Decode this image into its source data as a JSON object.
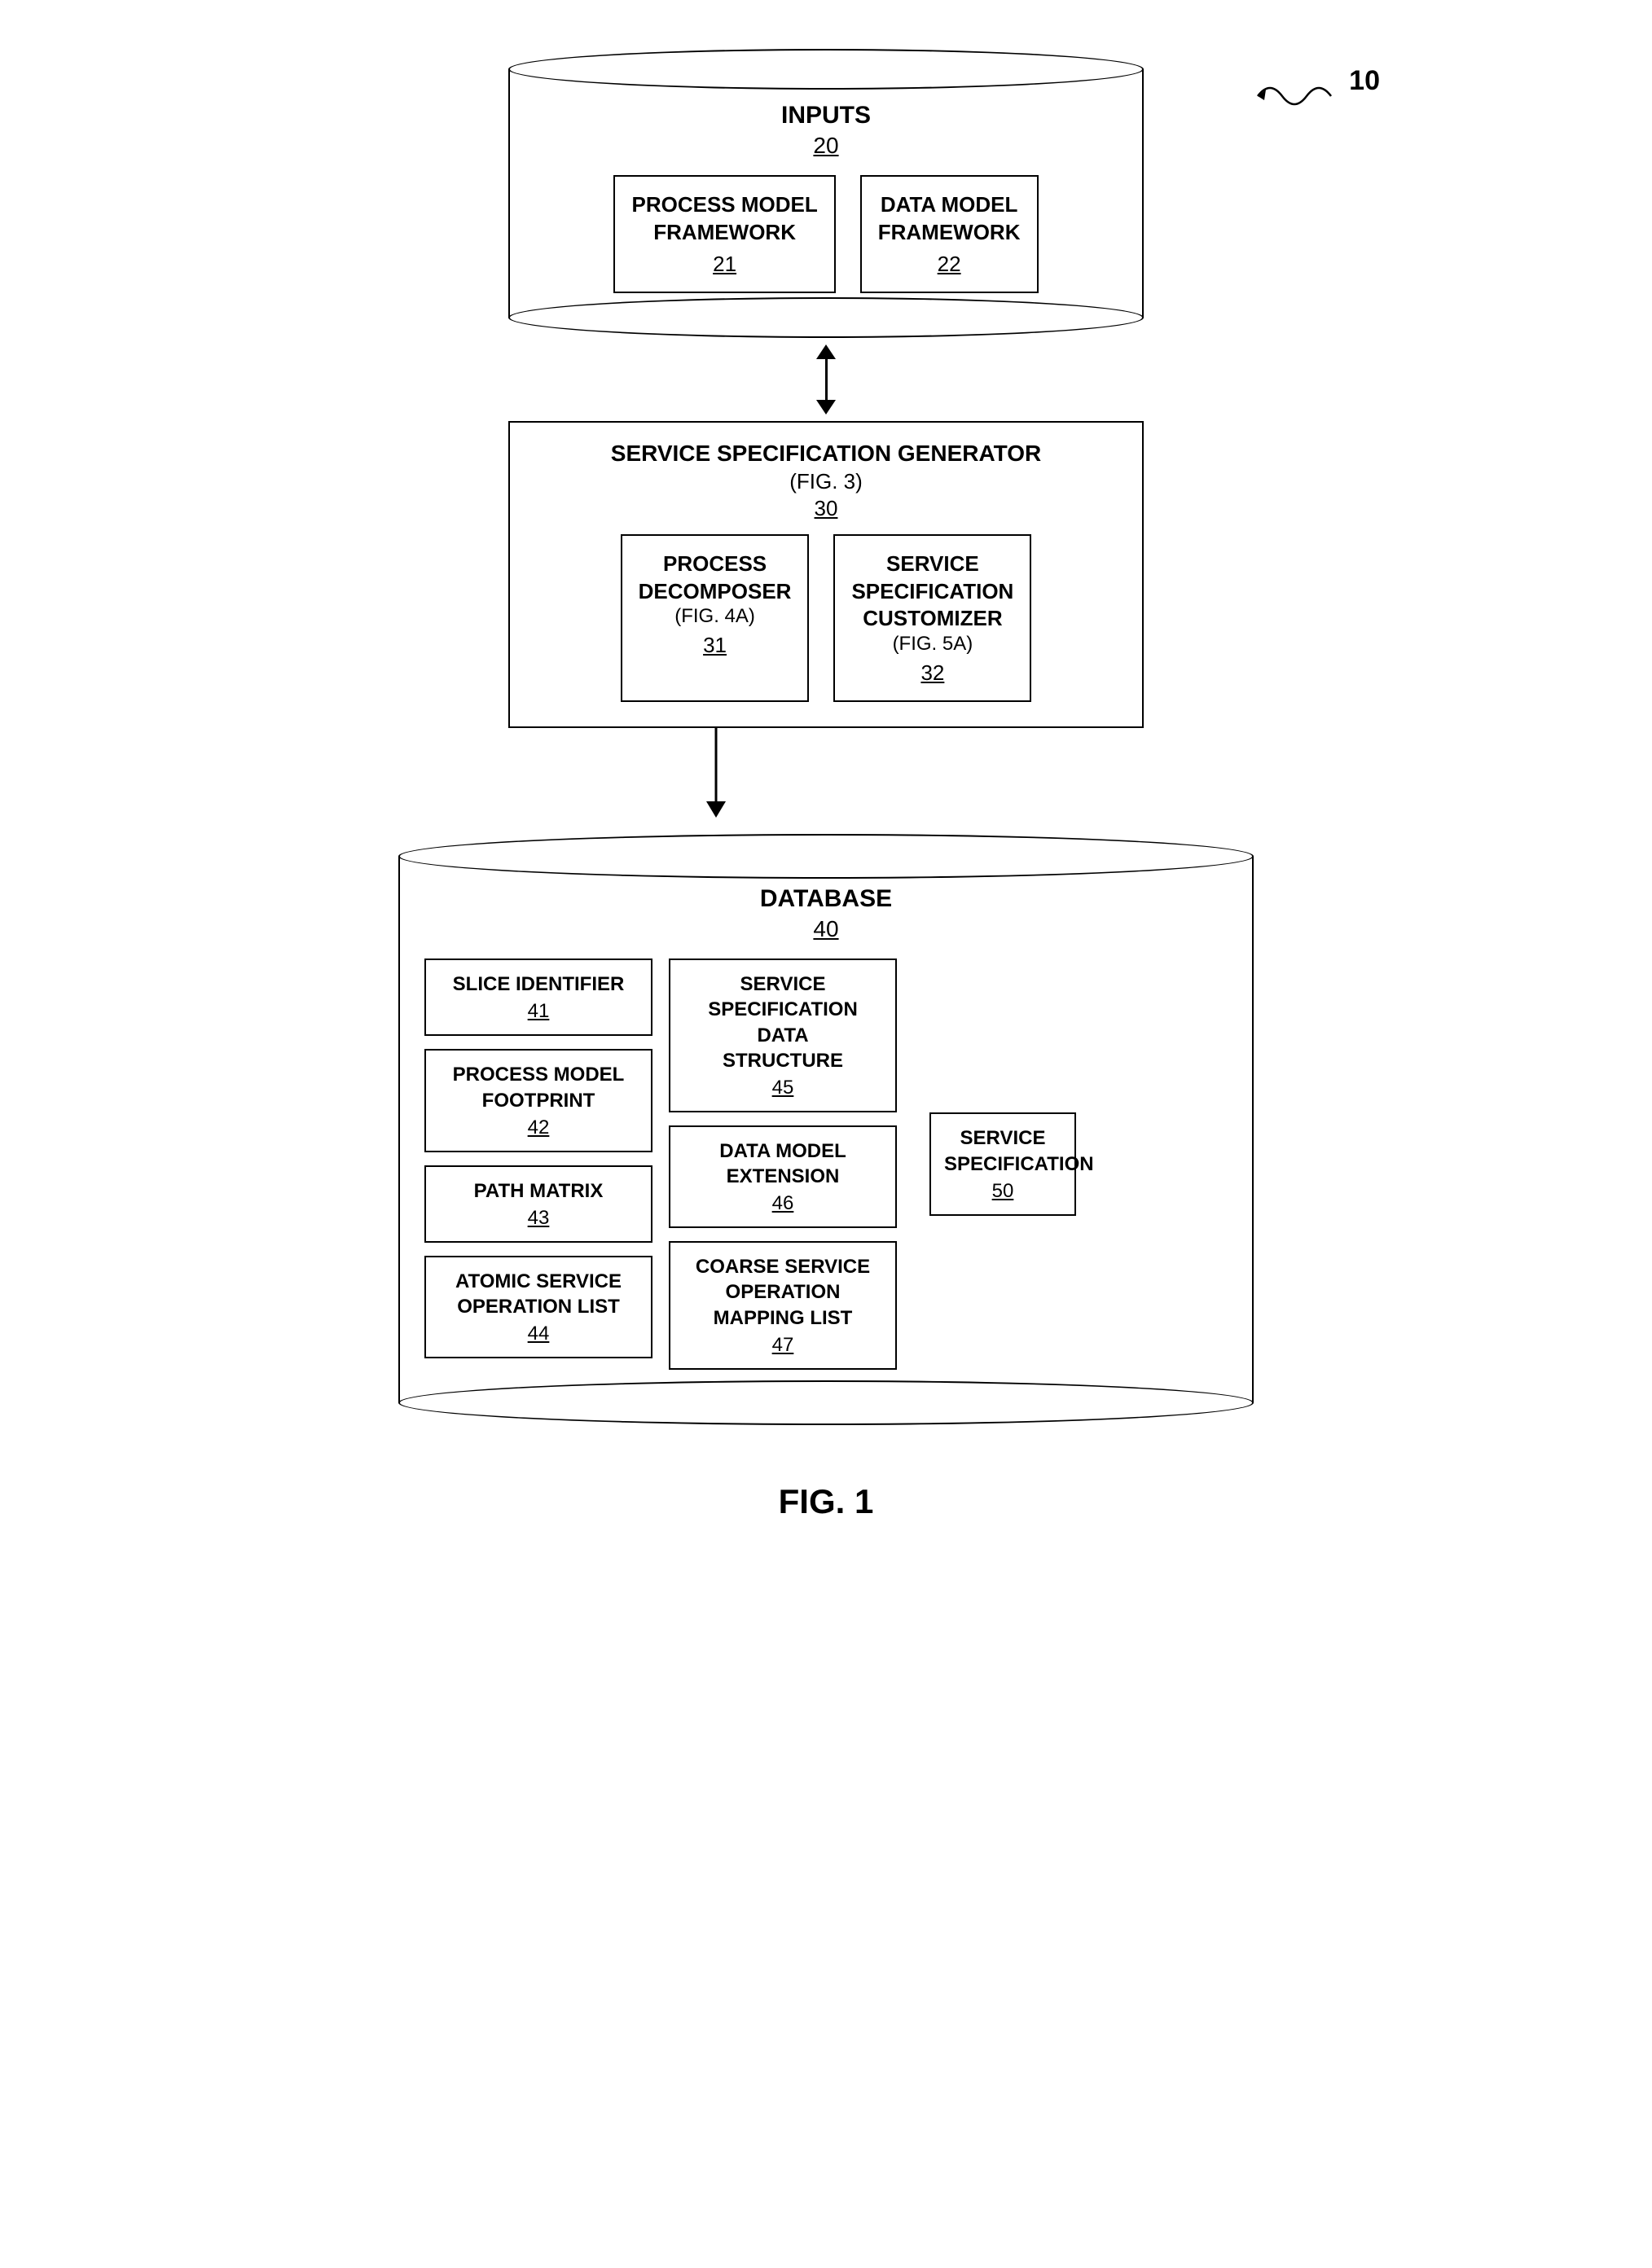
{
  "ref10": "10",
  "inputs": {
    "title": "INPUTS",
    "ref": "20",
    "boxes": [
      {
        "title": "PROCESS MODEL\nFRAMEWORK",
        "ref": "21"
      },
      {
        "title": "DATA MODEL\nFRAMEWORK",
        "ref": "22"
      }
    ]
  },
  "ssg": {
    "title": "SERVICE SPECIFICATION GENERATOR",
    "subtitle": "(FIG. 3)",
    "ref": "30",
    "boxes": [
      {
        "title": "PROCESS\nDECOMPOSER",
        "subtitle": "(FIG. 4A)",
        "ref": "31"
      },
      {
        "title": "SERVICE\nSPECIFICATION\nCUSTOMIZER",
        "subtitle": "(FIG. 5A)",
        "ref": "32"
      }
    ]
  },
  "database": {
    "title": "DATABASE",
    "ref": "40",
    "left_boxes": [
      {
        "title": "SLICE IDENTIFIER",
        "ref": "41"
      },
      {
        "title": "PROCESS MODEL\nFOOTPRINT",
        "ref": "42"
      },
      {
        "title": "PATH MATRIX",
        "ref": "43"
      },
      {
        "title": "ATOMIC SERVICE\nOPERATION LIST",
        "ref": "44"
      }
    ],
    "middle_boxes": [
      {
        "title": "SERVICE\nSPECIFICATION\nDATA\nSTRUCTURE",
        "ref": "45"
      },
      {
        "title": "DATA MODEL\nEXTENSION",
        "ref": "46"
      },
      {
        "title": "COARSE SERVICE\nOPERATION\nMAPPING LIST",
        "ref": "47"
      }
    ],
    "right_boxes": [
      {
        "title": "SERVICE\nSPECIFICATION",
        "ref": "50"
      }
    ]
  },
  "figure_caption": "FIG. 1"
}
